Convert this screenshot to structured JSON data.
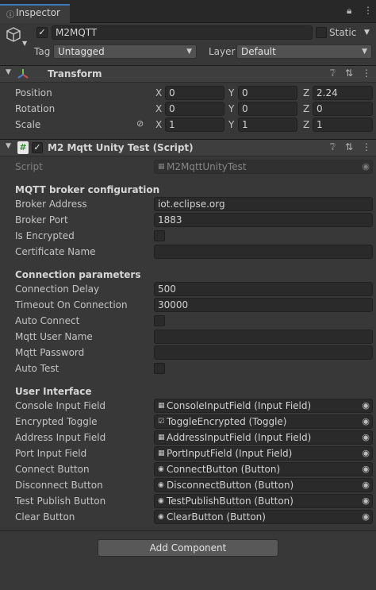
{
  "tab": {
    "title": "Inspector",
    "icon": "info-icon"
  },
  "gameobject": {
    "name": "M2MQTT",
    "active": true,
    "static_label": "Static",
    "tag_label": "Tag",
    "tag_value": "Untagged",
    "layer_label": "Layer",
    "layer_value": "Default"
  },
  "transform": {
    "title": "Transform",
    "rows": [
      {
        "label": "Position",
        "x": "0",
        "y": "0",
        "z": "2.24"
      },
      {
        "label": "Rotation",
        "x": "0",
        "y": "0",
        "z": "0"
      },
      {
        "label": "Scale",
        "x": "1",
        "y": "1",
        "z": "1"
      }
    ],
    "axes": {
      "x": "X",
      "y": "Y",
      "z": "Z"
    }
  },
  "script_component": {
    "title": "M2 Mqtt Unity Test (Script)",
    "enabled": true,
    "script_label": "Script",
    "script_value": "M2MqttUnityTest",
    "broker_section": "MQTT broker configuration",
    "broker_address_label": "Broker Address",
    "broker_address_value": "iot.eclipse.org",
    "broker_port_label": "Broker Port",
    "broker_port_value": "1883",
    "is_encrypted_label": "Is Encrypted",
    "is_encrypted_checked": false,
    "certificate_name_label": "Certificate Name",
    "certificate_name_value": "",
    "connection_section": "Connection parameters",
    "connection_delay_label": "Connection Delay",
    "connection_delay_value": "500",
    "timeout_label": "Timeout On Connection",
    "timeout_value": "30000",
    "auto_connect_label": "Auto Connect",
    "auto_connect_checked": false,
    "mqtt_user_label": "Mqtt User Name",
    "mqtt_user_value": "",
    "mqtt_password_label": "Mqtt Password",
    "mqtt_password_value": "",
    "auto_test_label": "Auto Test",
    "auto_test_checked": false,
    "ui_section": "User Interface",
    "ui_fields": [
      {
        "label": "Console Input Field",
        "value": "ConsoleInputField (Input Field)",
        "icon": "input-field-icon"
      },
      {
        "label": "Encrypted Toggle",
        "value": "ToggleEncrypted (Toggle)",
        "icon": "toggle-icon"
      },
      {
        "label": "Address Input Field",
        "value": "AddressInputField (Input Field)",
        "icon": "input-field-icon"
      },
      {
        "label": "Port Input Field",
        "value": "PortInputField (Input Field)",
        "icon": "input-field-icon"
      },
      {
        "label": "Connect Button",
        "value": "ConnectButton (Button)",
        "icon": "button-icon"
      },
      {
        "label": "Disconnect Button",
        "value": "DisconnectButton (Button)",
        "icon": "button-icon"
      },
      {
        "label": "Test Publish Button",
        "value": "TestPublishButton (Button)",
        "icon": "button-icon"
      },
      {
        "label": "Clear Button",
        "value": "ClearButton (Button)",
        "icon": "button-icon"
      }
    ]
  },
  "add_component_label": "Add Component",
  "colors": {
    "background": "#383838",
    "header": "#3e3e3e",
    "field": "#2a2a2a",
    "tab_accent": "#3a79bb"
  }
}
